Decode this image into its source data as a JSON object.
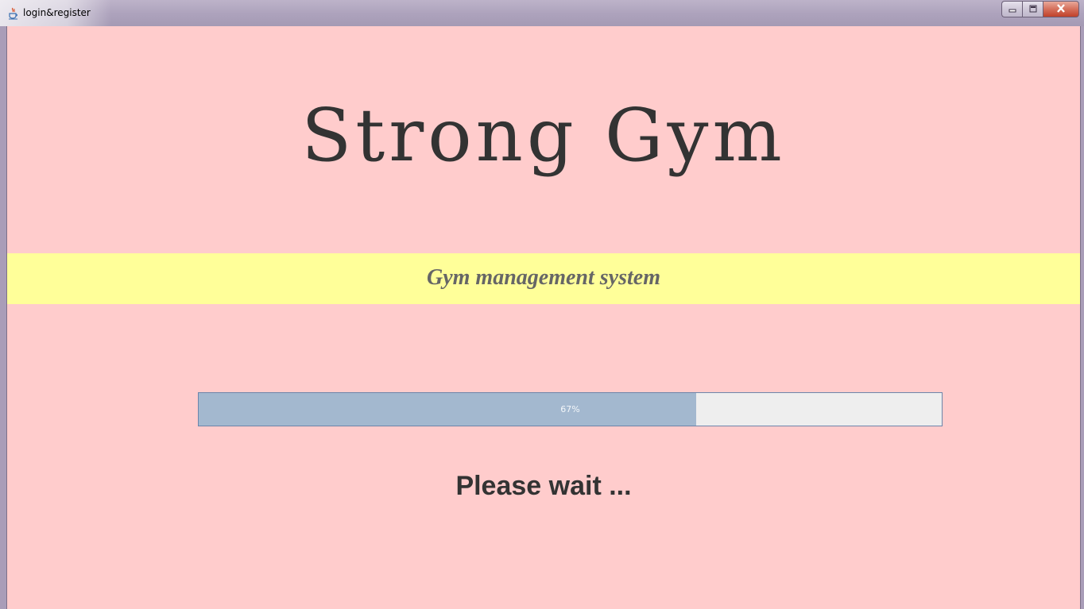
{
  "window": {
    "title": "login&register",
    "controls": {
      "minimize_icon": "minimize-icon",
      "maximize_icon": "maximize-icon",
      "close_icon": "close-icon"
    }
  },
  "splash": {
    "brand": "Strong Gym",
    "subtitle": "Gym management system",
    "status": "Please wait ..."
  },
  "progress": {
    "value": 67,
    "label": "67%"
  },
  "colors": {
    "background": "#ffcccc",
    "subtitle_band": "#ffff99",
    "progress_fill": "#a3b8cf",
    "progress_track": "#eeeeee",
    "text": "#333333"
  }
}
